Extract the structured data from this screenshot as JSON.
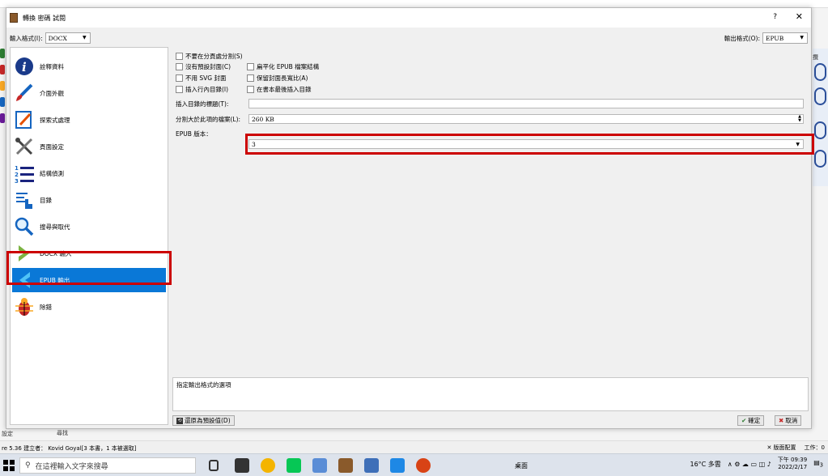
{
  "background": {
    "right_label": "攬",
    "footer_left": "設定",
    "footer_search": "尋找",
    "status_left": "re 5.36 建立者： Kovid Goyal[3 本書，1 本被選取]",
    "status_layout": "版面配置",
    "status_jobs": "工作：0"
  },
  "dialog": {
    "title": "轉換 密碼 試閱",
    "help": "?",
    "close": "✕",
    "input_format_label": "輸入格式(I):",
    "input_format_value": "DOCX",
    "output_format_label": "輸出格式(O):",
    "output_format_value": "EPUB"
  },
  "sidebar": {
    "items": [
      {
        "label": "詮釋資料"
      },
      {
        "label": "介面外觀"
      },
      {
        "label": "探索式處理"
      },
      {
        "label": "頁面設定"
      },
      {
        "label": "結構偵測"
      },
      {
        "label": "目錄"
      },
      {
        "label": "搜尋與取代"
      },
      {
        "label": "DOCX 輸入"
      },
      {
        "label": "EPUB 輸出"
      },
      {
        "label": "除錯"
      }
    ]
  },
  "options": {
    "no_split": "不要在分頁處分割(S)",
    "no_default_cover": "沒有預設封面(C)",
    "flatten": "扁平化 EPUB 檔案結構",
    "no_svg_cover": "不用 SVG 封面",
    "preserve_aspect": "保留封面長寬比(A)",
    "inline_toc": "插入行內目錄(I)",
    "toc_at_end": "在書本最後插入目錄",
    "toc_title_label": "插入目錄的標題(T):",
    "toc_title_value": "",
    "split_label": "分割大於此項的檔案(L):",
    "split_value": "260 KB",
    "version_label": "EPUB 版本：",
    "version_value": "3"
  },
  "help_text": "指定輸出格式的選項",
  "buttons": {
    "restore": "還原為預設值(D)",
    "ok": "確定",
    "cancel": "取消"
  },
  "taskbar": {
    "search_placeholder": "在這裡輸入文字來搜尋",
    "desktop": "桌面",
    "weather": "16°C 多雲",
    "time": "下午 09:39",
    "date": "2022/2/17",
    "notif_count": "3"
  }
}
